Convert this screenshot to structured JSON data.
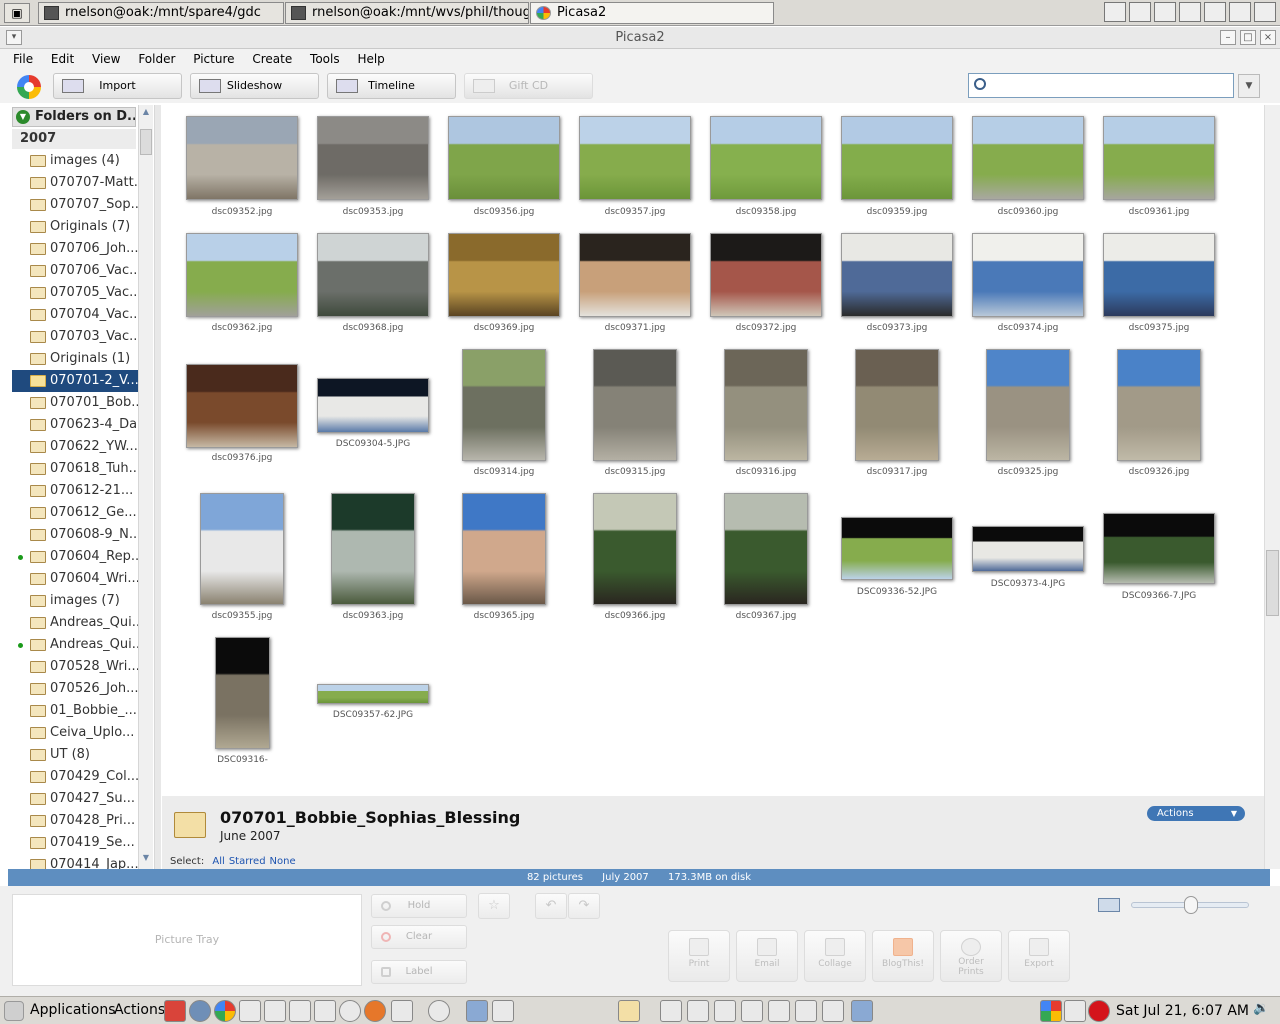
{
  "taskbar_top": {
    "tasks": [
      {
        "label": "rnelson@oak:/mnt/spare4/gdc"
      },
      {
        "label": "rnelson@oak:/mnt/wvs/phil/thoughtlet"
      },
      {
        "label": "Picasa2"
      }
    ]
  },
  "window": {
    "title": "Picasa2"
  },
  "menu": [
    "File",
    "Edit",
    "View",
    "Folder",
    "Picture",
    "Create",
    "Tools",
    "Help"
  ],
  "toolbar": {
    "import": "Import",
    "slideshow": "Slideshow",
    "timeline": "Timeline",
    "giftcd": "Gift CD",
    "search_placeholder": ""
  },
  "sidebar": {
    "header": "Folders on D...",
    "year": "2007",
    "items": [
      {
        "label": "images (4)",
        "dot": false,
        "selected": false
      },
      {
        "label": "070707-Matt...",
        "dot": false,
        "selected": false
      },
      {
        "label": "070707_Sop...",
        "dot": false,
        "selected": false
      },
      {
        "label": "Originals (7)",
        "dot": false,
        "selected": false
      },
      {
        "label": "070706_Joh...",
        "dot": false,
        "selected": false
      },
      {
        "label": "070706_Vac...",
        "dot": false,
        "selected": false
      },
      {
        "label": "070705_Vac...",
        "dot": false,
        "selected": false
      },
      {
        "label": "070704_Vac...",
        "dot": false,
        "selected": false
      },
      {
        "label": "070703_Vac...",
        "dot": false,
        "selected": false
      },
      {
        "label": "Originals (1)",
        "dot": false,
        "selected": false
      },
      {
        "label": "070701-2_V...",
        "dot": false,
        "selected": true
      },
      {
        "label": "070701_Bob...",
        "dot": false,
        "selected": false
      },
      {
        "label": "070623-4_Da...",
        "dot": false,
        "selected": false
      },
      {
        "label": "070622_YW...",
        "dot": false,
        "selected": false
      },
      {
        "label": "070618_Tuh...",
        "dot": false,
        "selected": false
      },
      {
        "label": "070612-21...",
        "dot": false,
        "selected": false
      },
      {
        "label": "070612_Ge...",
        "dot": false,
        "selected": false
      },
      {
        "label": "070608-9_N...",
        "dot": false,
        "selected": false
      },
      {
        "label": "070604_Rep...",
        "dot": true,
        "selected": false
      },
      {
        "label": "070604_Wri...",
        "dot": false,
        "selected": false
      },
      {
        "label": "images (7)",
        "dot": false,
        "selected": false
      },
      {
        "label": "Andreas_Qui...",
        "dot": false,
        "selected": false
      },
      {
        "label": "Andreas_Qui...",
        "dot": true,
        "selected": false
      },
      {
        "label": "070528_Wri...",
        "dot": false,
        "selected": false
      },
      {
        "label": "070526_Joh...",
        "dot": false,
        "selected": false
      },
      {
        "label": "01_Bobbie_...",
        "dot": false,
        "selected": false
      },
      {
        "label": "Ceiva_Uplo...",
        "dot": false,
        "selected": false
      },
      {
        "label": "UT (8)",
        "dot": false,
        "selected": false
      },
      {
        "label": "070429_Col...",
        "dot": false,
        "selected": false
      },
      {
        "label": "070427_Su...",
        "dot": false,
        "selected": false
      },
      {
        "label": "070428_Pri...",
        "dot": false,
        "selected": false
      },
      {
        "label": "070419_Se...",
        "dot": false,
        "selected": false
      },
      {
        "label": "070414_Jap...",
        "dot": false,
        "selected": false
      }
    ]
  },
  "photos": [
    {
      "name": "dsc09352.jpg",
      "palette": [
        "#9aa6b4",
        "#b8b2a6",
        "#7f7566"
      ]
    },
    {
      "name": "dsc09353.jpg",
      "palette": [
        "#8c8a86",
        "#6e6b66",
        "#a39f98"
      ]
    },
    {
      "name": "dsc09356.jpg",
      "palette": [
        "#aec6e0",
        "#7fa54a",
        "#6a8f3a"
      ]
    },
    {
      "name": "dsc09357.jpg",
      "palette": [
        "#bcd2e8",
        "#86ac4c",
        "#6b9538"
      ]
    },
    {
      "name": "dsc09358.jpg",
      "palette": [
        "#b5cde6",
        "#86b04e",
        "#6f9a3c"
      ]
    },
    {
      "name": "dsc09359.jpg",
      "palette": [
        "#b2cae4",
        "#83ad4b",
        "#6c963a"
      ]
    },
    {
      "name": "dsc09360.jpg",
      "palette": [
        "#b6cee6",
        "#86ac4d",
        "#a8a8a0"
      ]
    },
    {
      "name": "dsc09361.jpg",
      "palette": [
        "#b6cee6",
        "#86ac4d",
        "#a6a69e"
      ]
    },
    {
      "name": "dsc09362.jpg",
      "palette": [
        "#b9d0e8",
        "#86ac4d",
        "#a0a099"
      ]
    },
    {
      "name": "dsc09368.jpg",
      "palette": [
        "#cfd4d4",
        "#6b6f6a",
        "#3f4a3c"
      ]
    },
    {
      "name": "dsc09369.jpg",
      "palette": [
        "#8a6a2c",
        "#b89447",
        "#5a4422"
      ]
    },
    {
      "name": "dsc09371.jpg",
      "palette": [
        "#2a241e",
        "#c8a07a",
        "#e4e2dc"
      ]
    },
    {
      "name": "dsc09372.jpg",
      "palette": [
        "#1c1a18",
        "#a5564a",
        "#cfc6b8"
      ]
    },
    {
      "name": "dsc09373.jpg",
      "palette": [
        "#e8e8e4",
        "#4f6a98",
        "#2a2a2a"
      ]
    },
    {
      "name": "dsc09374.jpg",
      "palette": [
        "#f0f0ec",
        "#4a79b8",
        "#b8c8d8"
      ]
    },
    {
      "name": "dsc09375.jpg",
      "palette": [
        "#ecece8",
        "#3c6ba6",
        "#2c3a5c"
      ]
    },
    {
      "name": "dsc09376.jpg",
      "palette": [
        "#4a2a1c",
        "#7a4a2c",
        "#c6b8a4"
      ]
    },
    {
      "name": "DSC09304-5.JPG",
      "palette": [
        "#0d1624",
        "#e8e8e6",
        "#5a7aa8"
      ]
    },
    {
      "name": "dsc09314.jpg",
      "palette": [
        "#8aa068",
        "#6d7060",
        "#b8b6ac"
      ]
    },
    {
      "name": "dsc09315.jpg",
      "palette": [
        "#5b5a54",
        "#858277",
        "#b4b0a4"
      ]
    },
    {
      "name": "dsc09316.jpg",
      "palette": [
        "#6c6658",
        "#94907e",
        "#bcb6a2"
      ]
    },
    {
      "name": "dsc09317.jpg",
      "palette": [
        "#6a6052",
        "#928a74",
        "#b8ac94"
      ]
    },
    {
      "name": "dsc09325.jpg",
      "palette": [
        "#4f85c9",
        "#9a9282",
        "#bcb6a4"
      ]
    },
    {
      "name": "dsc09326.jpg",
      "palette": [
        "#4a82c8",
        "#a29a88",
        "#c0baa8"
      ]
    },
    {
      "name": "dsc09355.jpg",
      "palette": [
        "#7fa6d8",
        "#e8e8e8",
        "#8a8270"
      ]
    },
    {
      "name": "dsc09363.jpg",
      "palette": [
        "#1c3a2a",
        "#aeb8b0",
        "#4a5a3c"
      ]
    },
    {
      "name": "dsc09365.jpg",
      "palette": [
        "#3f78c6",
        "#d0a88c",
        "#6a5848"
      ]
    },
    {
      "name": "dsc09366.jpg",
      "palette": [
        "#c4c8b6",
        "#3a5a2e",
        "#2a2620"
      ]
    },
    {
      "name": "dsc09367.jpg",
      "palette": [
        "#b6bcb0",
        "#3a5a2e",
        "#2a2620"
      ]
    },
    {
      "name": "DSC09336-52.JPG",
      "palette": [
        "#0b0b0b",
        "#86ac4d",
        "#bcd2e8"
      ]
    },
    {
      "name": "DSC09373-4.JPG",
      "palette": [
        "#0b0b0b",
        "#e8e8e4",
        "#4f6a98"
      ]
    },
    {
      "name": "DSC09366-7.JPG",
      "palette": [
        "#0b0b0b",
        "#3a5a2e",
        "#b6bcb0"
      ]
    },
    {
      "name": "DSC09316-",
      "palette": [
        "#0b0b0b",
        "#7a7262",
        "#b0a892"
      ]
    },
    {
      "name": "DSC09357-62.JPG",
      "palette": [
        "#bcd2e8",
        "#86ac4d",
        "#6b9538"
      ]
    }
  ],
  "album": {
    "title": "070701_Bobbie_Sophias_Blessing",
    "date": "June 2007",
    "actions_label": "Actions",
    "select_label": "Select:",
    "select_all": "All",
    "select_starred": "Starred",
    "select_none": "None"
  },
  "status": {
    "pictures": "82 pictures",
    "month": "July 2007",
    "size": "173.3MB on disk"
  },
  "bottom": {
    "tray": "Picture Tray",
    "hold": "Hold",
    "clear": "Clear",
    "label": "Label",
    "print": "Print",
    "email": "Email",
    "collage": "Collage",
    "blogthis": "BlogThis!",
    "order_prints_1": "Order",
    "order_prints_2": "Prints",
    "export": "Export"
  },
  "taskbar_bottom": {
    "applications": "Applications",
    "actions": "Actions",
    "clock": "Sat Jul 21,  6:07 AM"
  }
}
